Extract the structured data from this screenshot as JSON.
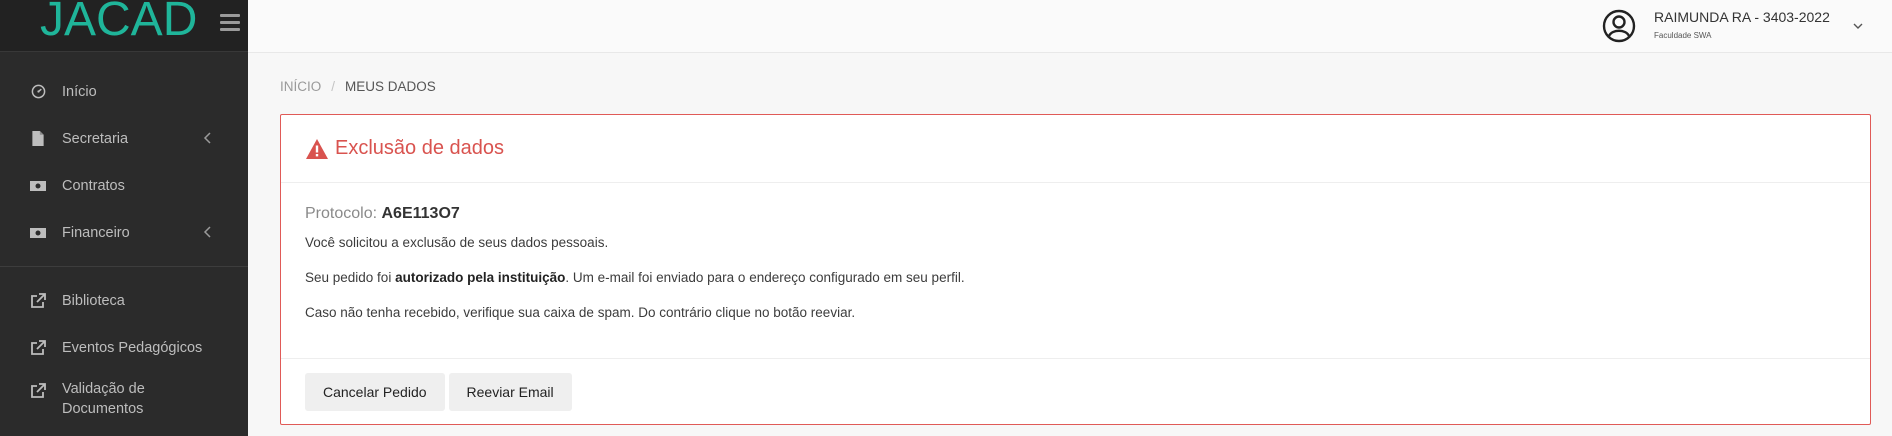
{
  "brand": {
    "logo_text": "JACAD"
  },
  "sidebar": {
    "items": [
      {
        "label": "Início",
        "icon": "dashboard-icon"
      },
      {
        "label": "Secretaria",
        "icon": "file-icon",
        "expandable": true
      },
      {
        "label": "Contratos",
        "icon": "money-icon"
      },
      {
        "label": "Financeiro",
        "icon": "money-icon",
        "expandable": true
      }
    ],
    "external_items": [
      {
        "label": "Biblioteca",
        "icon": "external-link-icon"
      },
      {
        "label": "Eventos Pedagógicos",
        "icon": "external-link-icon"
      },
      {
        "label": "Validação de Documentos",
        "icon": "external-link-icon"
      }
    ]
  },
  "user": {
    "name": "RAIMUNDA RA - 3403-2022",
    "college": "Faculdade SWA"
  },
  "breadcrumb": {
    "home": "INÍCIO",
    "separator": "/",
    "current": "MEUS DADOS"
  },
  "card": {
    "title": "Exclusão de dados",
    "protocol_label": "Protocolo:",
    "protocol_value": "A6E113O7",
    "p1": "Você solicitou a exclusão de seus dados pessoais.",
    "p2_before": "Seu pedido foi ",
    "p2_bold": "autorizado pela instituição",
    "p2_after": ". Um e-mail foi enviado para o endereço configurado em seu perfil.",
    "p3": "Caso não tenha recebido, verifique sua caixa de spam. Do contrário clique no botão reeviar.",
    "buttons": {
      "cancel": "Cancelar Pedido",
      "resend": "Reeviar Email"
    }
  },
  "colors": {
    "sidebar_bg": "#2b2b2b",
    "brand_accent": "#1fb59a",
    "danger": "#d9534f"
  }
}
